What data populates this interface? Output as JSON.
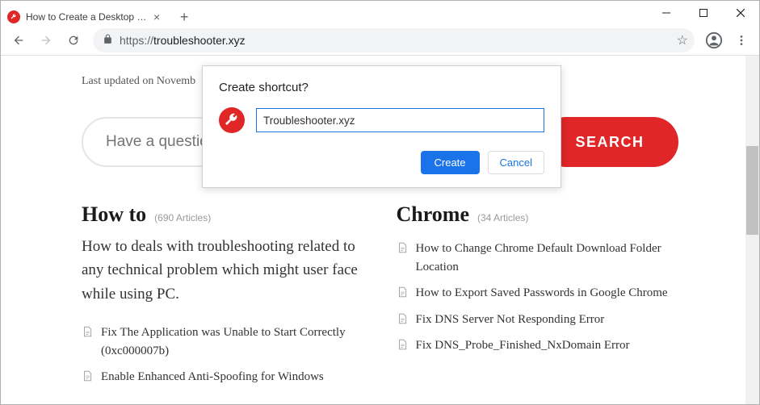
{
  "window": {
    "tab_title": "How to Create a Desktop Shortcu",
    "url_scheme": "https://",
    "url_host": "troubleshooter.xyz"
  },
  "dialog": {
    "title": "Create shortcut?",
    "input_value": "Troubleshooter.xyz",
    "create_label": "Create",
    "cancel_label": "Cancel"
  },
  "page": {
    "updated_prefix": "Last updated on Novemb",
    "search_placeholder": "Have a question",
    "search_button": "SEARCH"
  },
  "sections": {
    "howto": {
      "title": "How to",
      "count": "(690 Articles)",
      "desc": "How to deals with troubleshooting related to any technical problem which might user face while using PC.",
      "items": [
        "Fix The Application was Unable to Start Correctly (0xc000007b)",
        "Enable Enhanced Anti-Spoofing for Windows"
      ]
    },
    "chrome": {
      "title": "Chrome",
      "count": "(34 Articles)",
      "items": [
        "How to Change Chrome Default Download Folder Location",
        "How to Export Saved Passwords in Google Chrome",
        "Fix DNS Server Not Responding Error",
        "Fix DNS_Probe_Finished_NxDomain Error"
      ]
    }
  }
}
